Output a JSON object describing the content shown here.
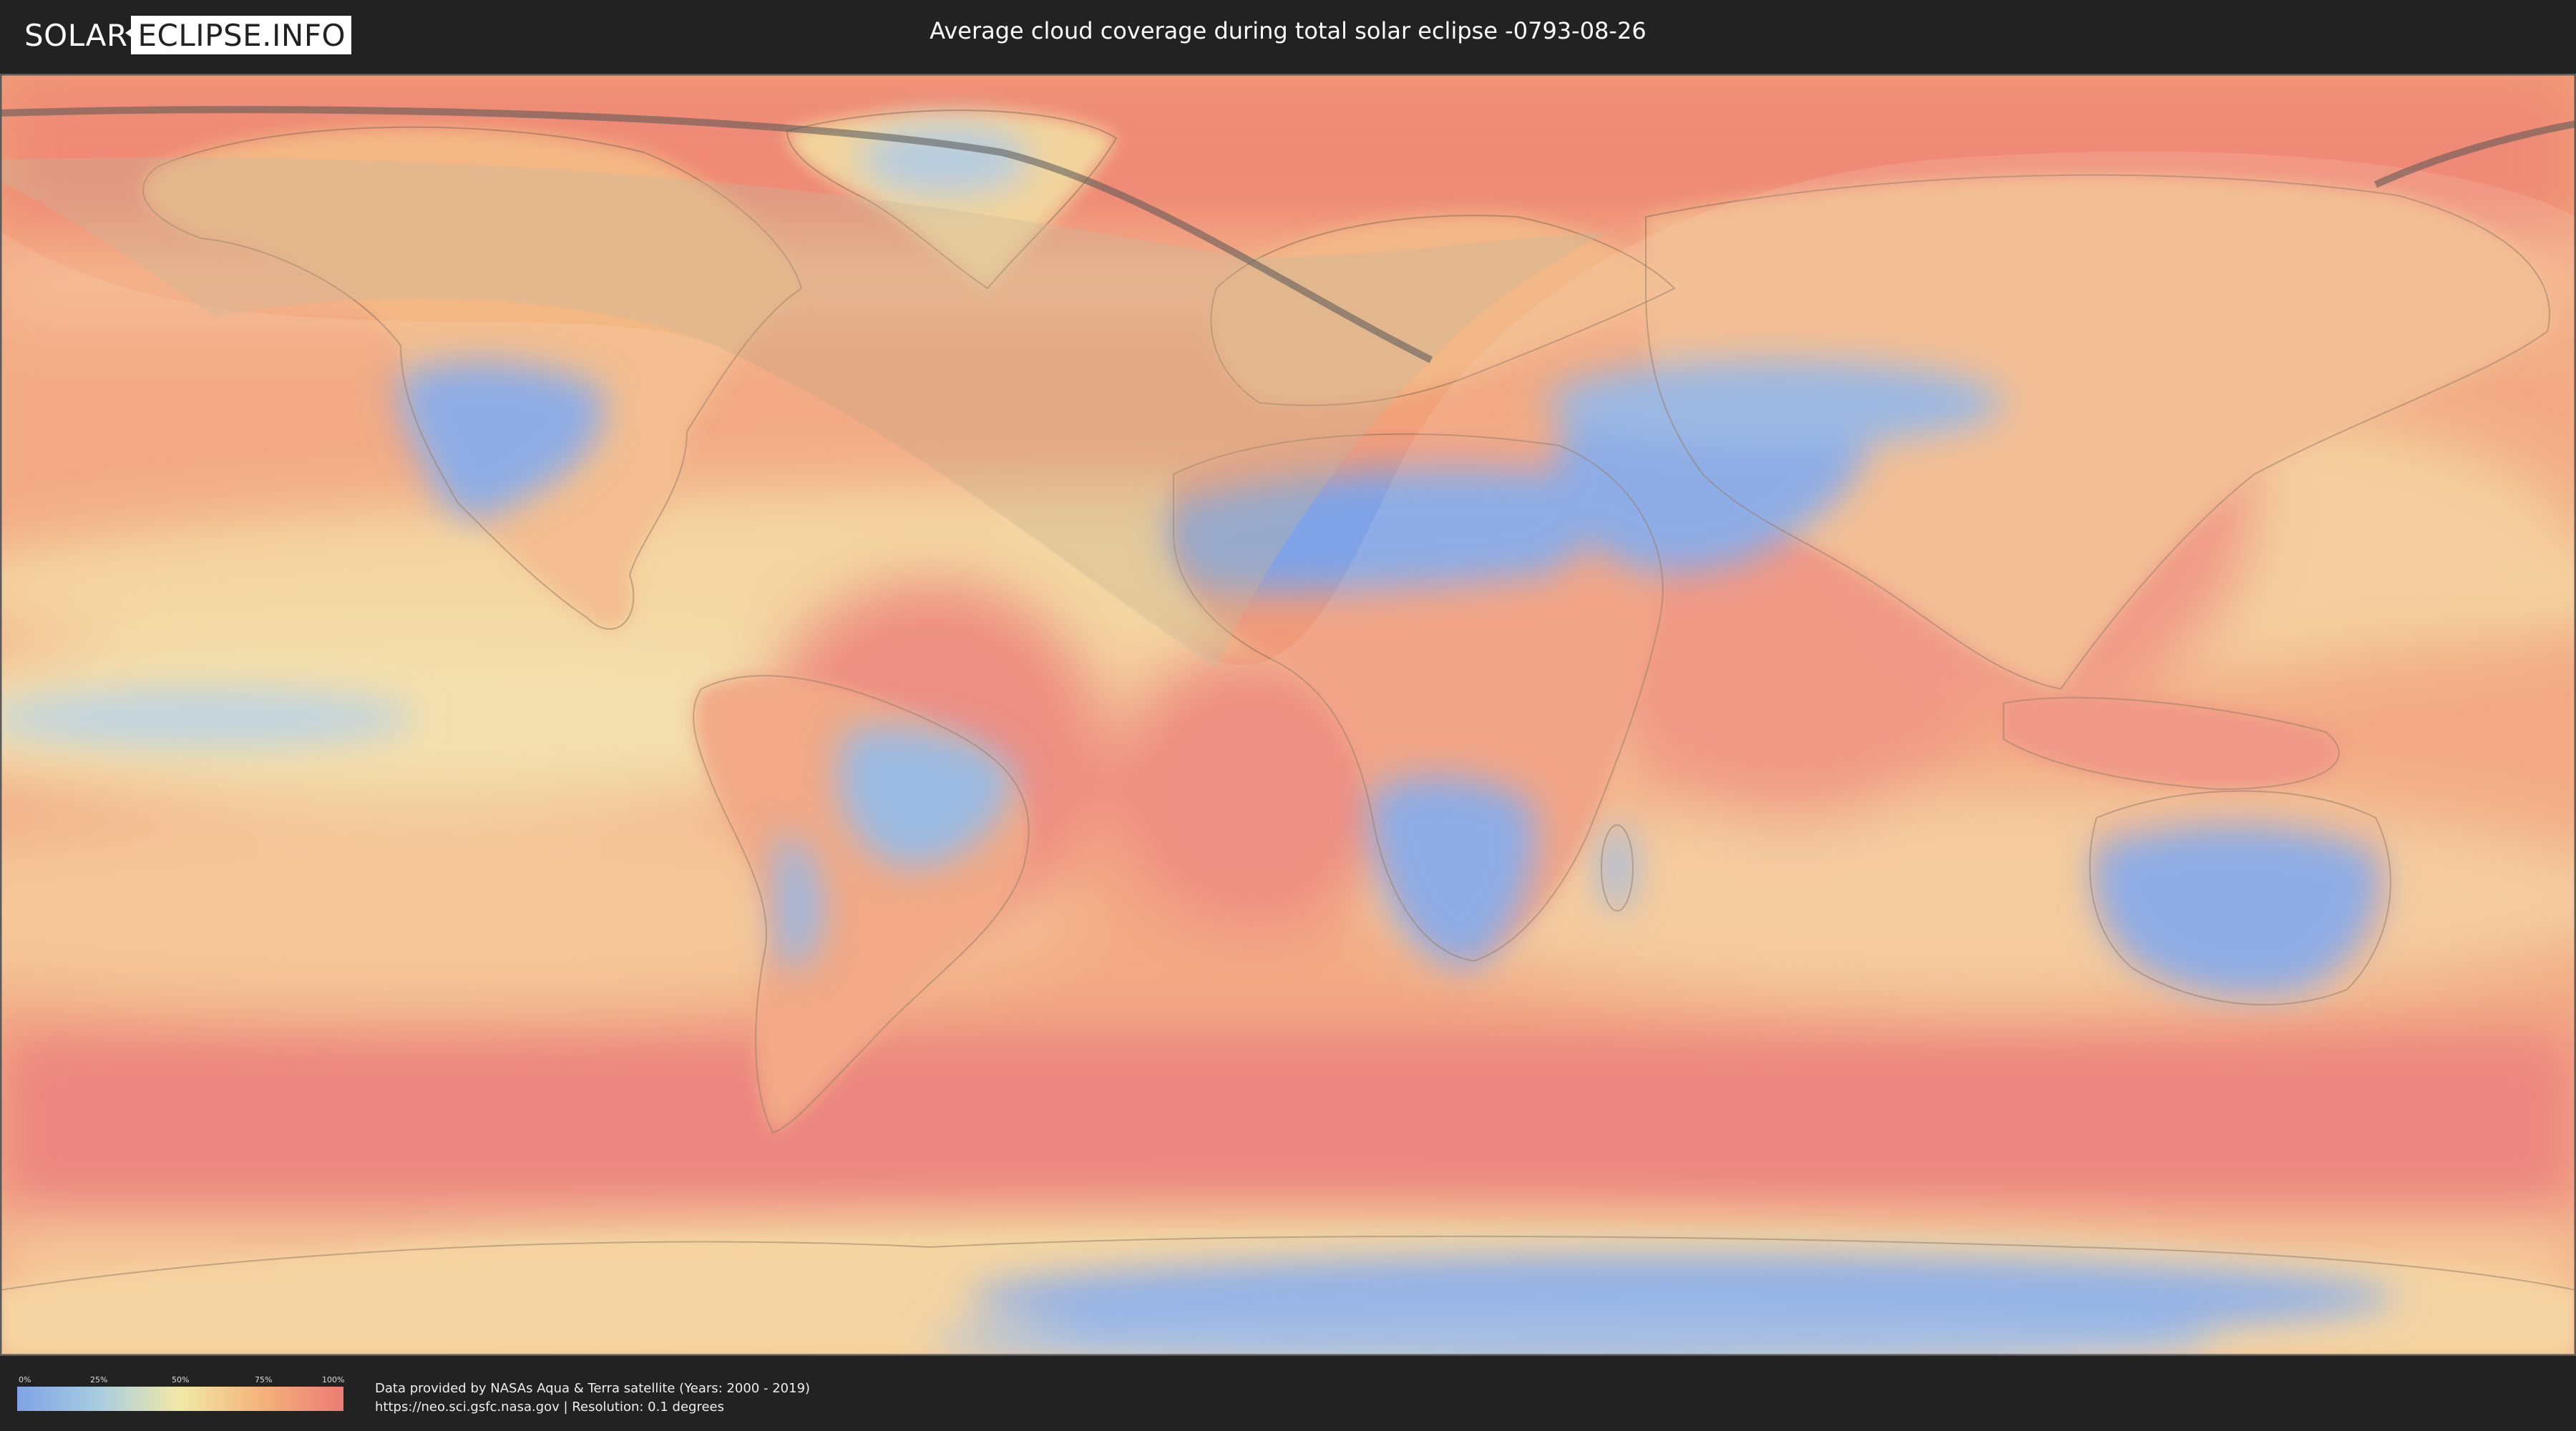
{
  "header": {
    "logo_left": "SOLAR",
    "logo_right": "ECLIPSE.INFO",
    "title": "Average cloud coverage during total solar eclipse -0793-08-26"
  },
  "legend": {
    "ticks": [
      "0%",
      "25%",
      "50%",
      "75%",
      "100%"
    ],
    "colors": [
      "#7fa3e6",
      "#a8cde0",
      "#f2e8a6",
      "#f4b27a",
      "#ec7b74"
    ]
  },
  "footer": {
    "credit_line1": "Data provided by NASAs Aqua & Terra satellite (Years: 2000 - 2019)",
    "credit_line2": "https://neo.sci.gsfc.nasa.gov | Resolution: 0.1 degrees"
  },
  "map": {
    "colors": {
      "ocean_cloudy": "#ec7b74",
      "ocean_mid": "#f4b27a",
      "clear_sky": "#7fa3e6",
      "partial": "#f2e8a6",
      "coastline": "#8a6f5a",
      "path": "#555555"
    }
  }
}
